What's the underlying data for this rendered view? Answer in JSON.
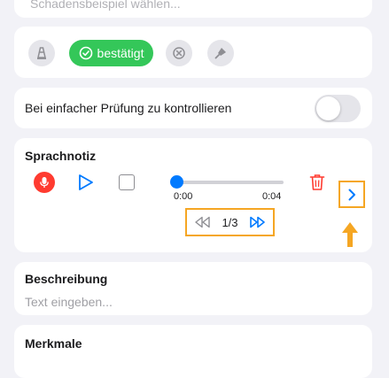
{
  "top_card": {
    "placeholder": "Schadensbeispiel wählen..."
  },
  "status": {
    "selected_label": "bestätigt",
    "icons": [
      "traffic-cone-icon",
      "check-circle-icon",
      "x-circle-icon",
      "trowel-icon"
    ],
    "accent_color": "#34c759"
  },
  "toggle_row": {
    "label": "Bei einfacher Prüfung zu kontrollieren",
    "on": false
  },
  "voice_note": {
    "title": "Sprachnotiz",
    "time_current": "0:00",
    "time_total": "0:04",
    "progress": 0,
    "page": "1/3",
    "highlight_color": "#f5a623"
  },
  "description": {
    "title": "Beschreibung",
    "placeholder": "Text eingeben..."
  },
  "traits": {
    "title": "Merkmale"
  }
}
